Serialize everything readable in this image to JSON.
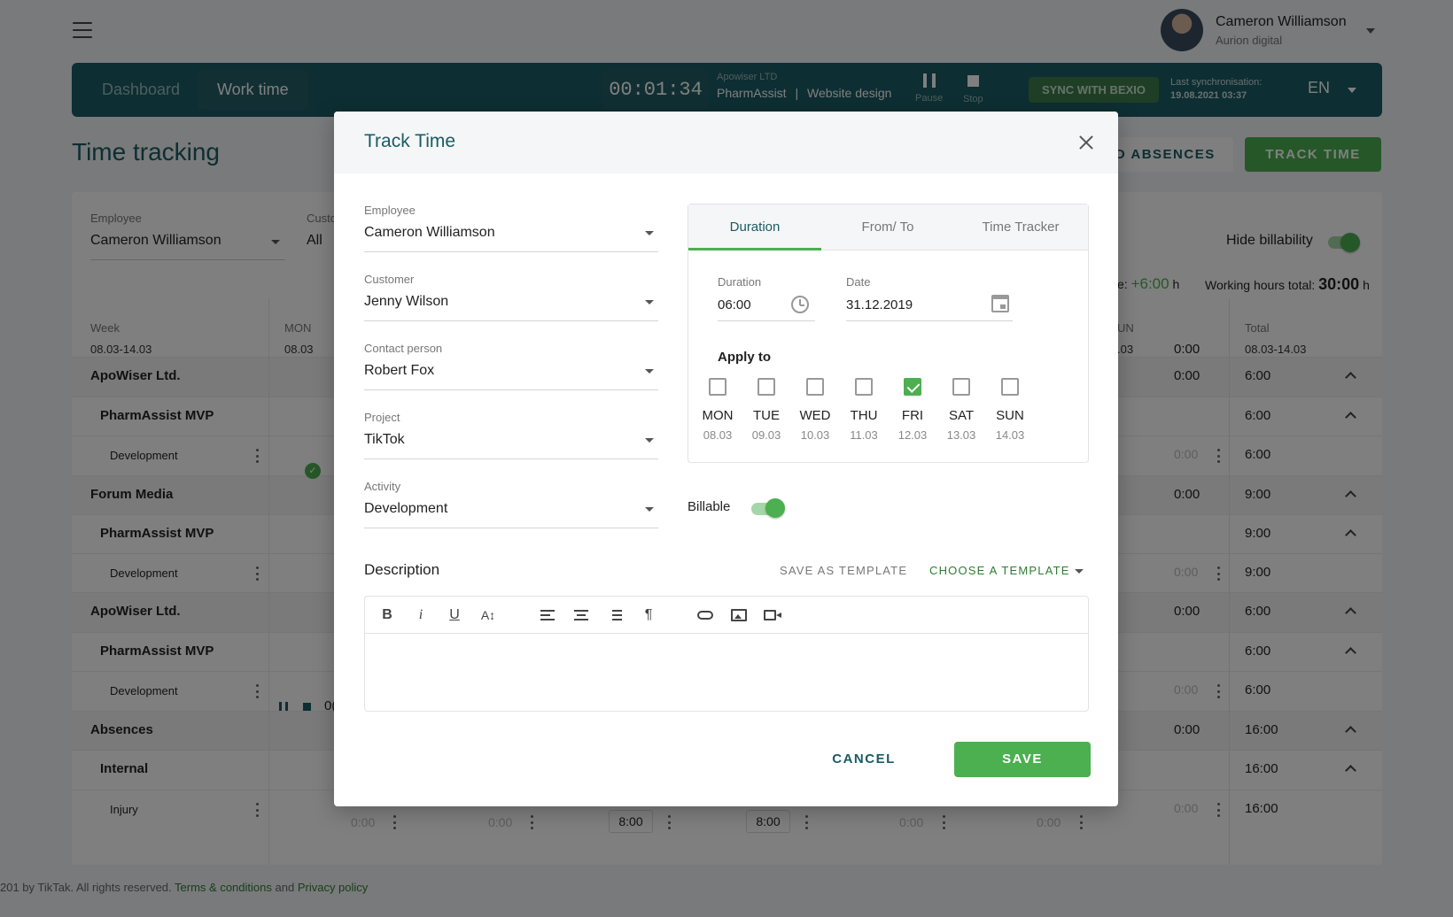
{
  "user": {
    "name": "Cameron Williamson",
    "org": "Aurion digital"
  },
  "nav": {
    "tabs": [
      "Dashboard",
      "Work time"
    ],
    "timer": "00:01:34",
    "company": "Apowiser LTD",
    "project": "PharmAssist",
    "separator": "|",
    "task": "Website design",
    "pause": "Pause",
    "stop": "Stop",
    "sync": "SYNC WITH BEXIO",
    "last_sync_label": "Last synchronisation:",
    "last_sync_value": "19.08.2021 03:37",
    "lang": "EN"
  },
  "page": {
    "title": "Time tracking",
    "add_absences": "ADD ABSENCES",
    "track_time": "TRACK TIME"
  },
  "filters": {
    "employee_label": "Employee",
    "employee_value": "Cameron Williamson",
    "customer_label": "Customer",
    "customer_value": "All",
    "hide_billability": "Hide billability",
    "overtime_prefix": "e:",
    "overtime_value": "+6:00",
    "hours_unit": "h",
    "working_total_label": "Working hours total:",
    "working_total_value": "30:00"
  },
  "table": {
    "week_label": "Week",
    "week_value": "08.03-14.03",
    "mon_label": "MON",
    "mon_date": "08.03",
    "sun_label": "UN",
    "sun_date": ".03",
    "sun_total": "0:00",
    "total_label": "Total",
    "total_value": "08.03-14.03",
    "rows": [
      {
        "label": "ApoWiser Ltd.",
        "kind": "group",
        "sun": "0:00",
        "total": "6:00"
      },
      {
        "label": "PharmAssist MVP",
        "kind": "project",
        "sun": "",
        "total": "6:00"
      },
      {
        "label": "Development",
        "kind": "task",
        "sun": "0:00",
        "total": "6:00"
      },
      {
        "label": "Forum Media",
        "kind": "group",
        "sun": "0:00",
        "total": "9:00"
      },
      {
        "label": "PharmAssist MVP",
        "kind": "project",
        "sun": "",
        "total": "9:00"
      },
      {
        "label": "Development",
        "kind": "task",
        "sun": "0:00",
        "total": "9:00"
      },
      {
        "label": "ApoWiser Ltd.",
        "kind": "group",
        "sun": "0:00",
        "total": "6:00"
      },
      {
        "label": "PharmAssist MVP",
        "kind": "project",
        "sun": "",
        "total": "6:00"
      },
      {
        "label": "Development",
        "kind": "task",
        "sun": "0:00",
        "total": "6:00"
      },
      {
        "label": "Absences",
        "kind": "group",
        "sun": "0:00",
        "total": "16:00"
      },
      {
        "label": "Internal",
        "kind": "project",
        "sun": "",
        "total": "16:00"
      },
      {
        "label": "Injury",
        "kind": "task",
        "sun": "0:00",
        "total": "16:00"
      }
    ],
    "running_cell": "0(",
    "injury_cells": [
      "0:00",
      "0:00",
      "8:00",
      "8:00",
      "0:00",
      "0:00"
    ]
  },
  "footer": {
    "prefix": "201 by TikTak. All rights reserved.",
    "terms": "Terms & conditions",
    "and": "and",
    "privacy": "Privacy policy"
  },
  "modal": {
    "title": "Track Time",
    "fields": [
      {
        "label": "Employee",
        "value": "Cameron Williamson"
      },
      {
        "label": "Customer",
        "value": "Jenny Wilson"
      },
      {
        "label": "Contact person",
        "value": "Robert Fox"
      },
      {
        "label": "Project",
        "value": "TikTok"
      },
      {
        "label": "Activity",
        "value": "Development"
      }
    ],
    "tabs": [
      "Duration",
      "From/ To",
      "Time Tracker"
    ],
    "duration_label": "Duration",
    "duration_value": "06:00",
    "date_label": "Date",
    "date_value": "31.12.2019",
    "apply_to": "Apply to",
    "days": [
      {
        "name": "MON",
        "date": "08.03",
        "checked": false
      },
      {
        "name": "TUE",
        "date": "09.03",
        "checked": false
      },
      {
        "name": "WED",
        "date": "10.03",
        "checked": false
      },
      {
        "name": "THU",
        "date": "11.03",
        "checked": false
      },
      {
        "name": "FRI",
        "date": "12.03",
        "checked": true
      },
      {
        "name": "SAT",
        "date": "13.03",
        "checked": false
      },
      {
        "name": "SUN",
        "date": "14.03",
        "checked": false
      }
    ],
    "billable": "Billable",
    "description": "Description",
    "save_template": "SAVE AS TEMPLATE",
    "choose_template": "CHOOSE A TEMPLATE",
    "editor": {
      "bold": "B",
      "italic": "i",
      "underline": "U",
      "font_size": "A↕",
      "paragraph": "¶"
    },
    "cancel": "CANCEL",
    "save": "SAVE"
  },
  "colors": {
    "brand": "#1a5c64",
    "accent": "#4caf50"
  }
}
